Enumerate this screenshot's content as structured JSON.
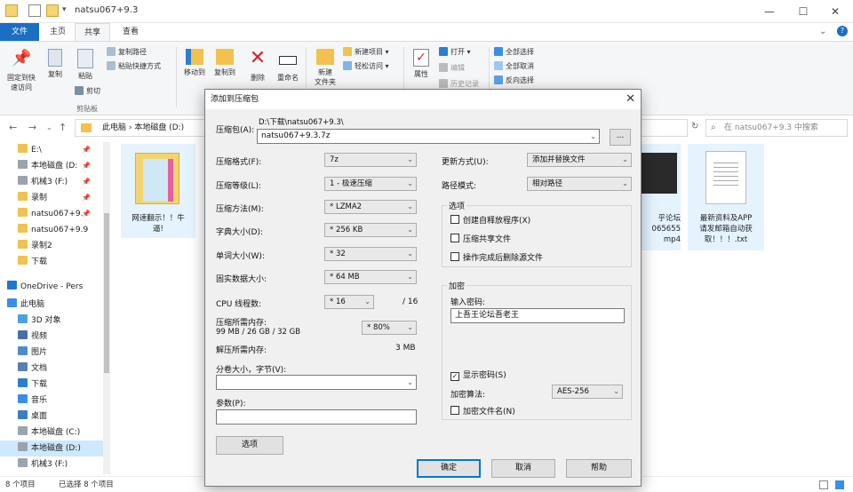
{
  "window": {
    "title": "natsu067+9.3",
    "controls": {
      "minimize": "—",
      "maximize": "☐",
      "close": "✕"
    }
  },
  "tabs": [
    {
      "label": "文件"
    },
    {
      "label": "主页"
    },
    {
      "label": "共享"
    },
    {
      "label": "查看"
    }
  ],
  "ribbon": {
    "pin_quick": "固定到快\n速访问",
    "copy": "复制",
    "paste": "粘贴",
    "copy_path": "复制路径",
    "paste_shortcut": "粘贴快捷方式",
    "cut": "剪切",
    "clipboard_group": "剪贴板",
    "move_to": "移动到",
    "copy_to": "复制到",
    "delete": "删除",
    "rename": "重命名",
    "new_folder": "新建\n文件夹",
    "new_item": "新建项目",
    "easy_access": "轻松访问",
    "properties": "属性",
    "open": "打开",
    "edit": "编辑",
    "history": "历史记录",
    "select_all": "全部选择",
    "select_none": "全部取消",
    "invert": "反向选择"
  },
  "address": {
    "path": "此电脑  ›  本地磁盘 (D:)",
    "search_placeholder": "在 natsu067+9.3 中搜索"
  },
  "navpane": [
    {
      "label": "E:\\",
      "pinned": true,
      "color": "#f2c14e"
    },
    {
      "label": "本地磁盘 (D:",
      "pinned": true,
      "color": "#9aa4ad"
    },
    {
      "label": "机械3 (F:)",
      "pinned": true,
      "color": "#9aa4ad"
    },
    {
      "label": "录制",
      "pinned": true,
      "color": "#f2c14e"
    },
    {
      "label": "natsu067+9.",
      "pinned": true,
      "color": "#f2c14e"
    },
    {
      "label": "natsu067+9.9",
      "pinned": false,
      "color": "#f2c14e"
    },
    {
      "label": "录制2",
      "pinned": false,
      "color": "#f2c14e"
    },
    {
      "label": "下载",
      "pinned": false,
      "color": "#f2c14e"
    },
    {
      "label": "OneDrive - Pers",
      "pinned": false,
      "color": "#1b78d0"
    },
    {
      "label": "此电脑",
      "pinned": false,
      "color": "#3a8ee6"
    },
    {
      "label": "3D 对象",
      "pinned": false,
      "color": "#4aa3df"
    },
    {
      "label": "视频",
      "pinned": false,
      "color": "#4a6fa5"
    },
    {
      "label": "图片",
      "pinned": false,
      "color": "#4a90c8"
    },
    {
      "label": "文档",
      "pinned": false,
      "color": "#5a7fb0"
    },
    {
      "label": "下载",
      "pinned": false,
      "color": "#2b7fd0"
    },
    {
      "label": "音乐",
      "pinned": false,
      "color": "#3a8ee6"
    },
    {
      "label": "桌面",
      "pinned": false,
      "color": "#3a7fc0"
    },
    {
      "label": "本地磁盘 (C:)",
      "pinned": false,
      "color": "#9aa4ad"
    },
    {
      "label": "本地磁盘 (D:)",
      "pinned": false,
      "color": "#9aa4ad",
      "selected": true
    },
    {
      "label": "机械3 (F:)",
      "pinned": false,
      "color": "#9aa4ad"
    }
  ],
  "files": [
    {
      "name": "网速翻示！！牛\n逼!",
      "kind": "folder"
    },
    {
      "name": "乎论坛\n065655\nmp4",
      "kind": "video"
    },
    {
      "name": "最新资料及APP\n请发邮箱自动获\n取！！！.txt",
      "kind": "text"
    }
  ],
  "status": {
    "count": "8 个项目",
    "selected": "已选择 8 个项目"
  },
  "dialog": {
    "title": "添加到压缩包",
    "close": "✕",
    "archive_label": "压缩包(A):",
    "archive_dir": "D:\\下载\\natsu067+9.3\\",
    "archive_name": "natsu067+9.3.7z",
    "browse": "...",
    "format_label": "压缩格式(F):",
    "format_value": "7z",
    "level_label": "压缩等级(L):",
    "level_value": "1 - 极速压缩",
    "method_label": "压缩方法(M):",
    "method_value": "* LZMA2",
    "dict_label": "字典大小(D):",
    "dict_value": "* 256 KB",
    "word_label": "单词大小(W):",
    "word_value": "* 32",
    "solid_label": "固实数据大小:",
    "solid_value": "* 64 MB",
    "cpu_label": "CPU 线程数:",
    "cpu_value": "* 16",
    "cpu_max": "/ 16",
    "mem_label": "压缩所需内存:",
    "mem_value": "99 MB / 26 GB / 32 GB",
    "mem_pct": "* 80%",
    "demem_label": "解压所需内存:",
    "demem_value": "3 MB",
    "split_label": "分卷大小，字节(V):",
    "split_value": "",
    "params_label": "参数(P):",
    "params_value": "",
    "options_button": "选项",
    "update_label": "更新方式(U):",
    "update_value": "添加并替换文件",
    "path_label": "路径模式:",
    "path_value": "相对路径",
    "options_group": "选项",
    "opt_sfx": "创建自释放程序(X)",
    "opt_shared": "压缩共享文件",
    "opt_delete": "操作完成后删除源文件",
    "enc_group": "加密",
    "pwd_label": "输入密码:",
    "pwd_value": "上吾王论坛吾老王",
    "show_pwd": "显示密码(S)",
    "show_pwd_checked": "✓",
    "enc_method_label": "加密算法:",
    "enc_method_value": "AES-256",
    "enc_names": "加密文件名(N)",
    "ok": "确定",
    "cancel": "取消",
    "help": "帮助"
  }
}
